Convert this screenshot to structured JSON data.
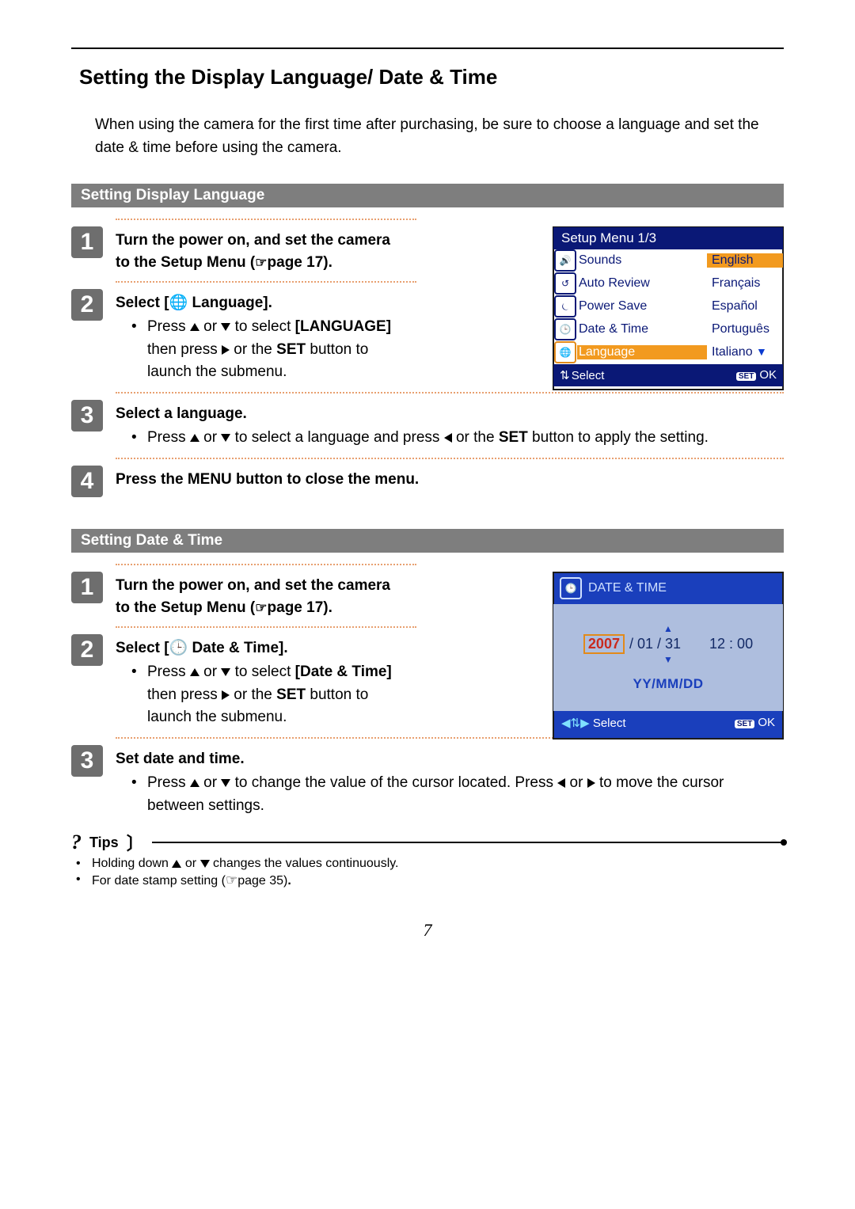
{
  "title": "Setting the Display Language/ Date & Time",
  "intro": "When using the camera for the first time after purchasing, be sure to choose a language and set the date & time before using the camera.",
  "section_lang": "Setting Display Language",
  "section_dt": "Setting Date & Time",
  "lang_steps": {
    "s1": "Turn the power on, and set the camera to the Setup Menu (",
    "s1_page": "page 17).",
    "s2_lead": "Select [",
    "s2_label": " Language].",
    "s2_b1a": "Press ",
    "s2_b1b": " or ",
    "s2_b1c": " to select ",
    "s2_b1d": "[LANGUAGE]",
    "s2_b1e": " then press ",
    "s2_b1f": " or the ",
    "s2_b1g": "SET",
    "s2_b1h": " button to launch the submenu.",
    "s3_lead": "Select a language.",
    "s3_b1a": "Press ",
    "s3_b1b": " or ",
    "s3_b1c": " to select a language and press ",
    "s3_b1d": " or the ",
    "s3_b1e": "SET",
    "s3_b1f": " button to apply the setting.",
    "s4": "Press the MENU button to close the menu."
  },
  "dt_steps": {
    "s1": "Turn the power on, and set the camera to the Setup Menu (",
    "s1_page": "page 17).",
    "s2_lead": "Select [",
    "s2_label": "  Date & Time].",
    "s2_b1a": "Press ",
    "s2_b1b": " or ",
    "s2_b1c": " to select ",
    "s2_b1d": "[Date & Time]",
    "s2_b1e": " then press ",
    "s2_b1f": " or the ",
    "s2_b1g": "SET",
    "s2_b1h": " button to launch the submenu.",
    "s3_lead": "Set date and time.",
    "s3_b1a": "Press ",
    "s3_b1b": " or ",
    "s3_b1c": " to change the value of the cursor located. Press ",
    "s3_b1d": " or ",
    "s3_b1e": " to move the cursor between settings."
  },
  "tips": {
    "label": "Tips",
    "t1a": "Holding down ",
    "t1b": " or ",
    "t1c": " changes the values continuously.",
    "t2a": "For date stamp setting (",
    "t2b": "page 35)",
    "t2c": "."
  },
  "setup_menu": {
    "title": "Setup Menu 1/3",
    "rows": [
      {
        "label": "Sounds",
        "value": "English",
        "value_sel": true
      },
      {
        "label": "Auto Review",
        "value": "Français"
      },
      {
        "label": "Power Save",
        "value": "Español"
      },
      {
        "label": "Date & Time",
        "value": "Português"
      },
      {
        "label": "Language",
        "value": "Italiano",
        "row_sel": true
      }
    ],
    "footer_select": "Select",
    "footer_ok": "OK",
    "set_chip": "SET"
  },
  "dt_screen": {
    "title": "DATE & TIME",
    "year": "2007",
    "month": " / 01 / 31",
    "time": "12 : 00",
    "format": "YY/MM/DD",
    "footer_select": "Select",
    "footer_ok": "OK",
    "set_chip": "SET"
  },
  "page_number": "7"
}
